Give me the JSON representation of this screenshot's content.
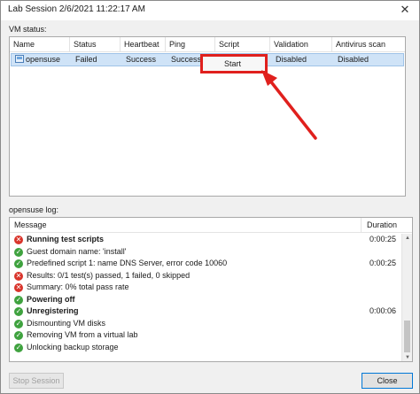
{
  "window": {
    "title": "Lab Session 2/6/2021 11:22:17 AM",
    "close_glyph": "✕"
  },
  "vm_status": {
    "label": "VM status:",
    "columns": [
      "Name",
      "Status",
      "Heartbeat",
      "Ping",
      "Script",
      "Validation",
      "Antivirus scan"
    ],
    "rows": [
      {
        "name": "opensuse",
        "status": "Failed",
        "heartbeat": "Success",
        "ping": "Success",
        "script": "",
        "validation": "Disabled",
        "antivirus": "Disabled"
      }
    ]
  },
  "context_menu": {
    "items": [
      "Start"
    ]
  },
  "log": {
    "label": "opensuse log:",
    "columns": [
      "Message",
      "Duration"
    ],
    "rows": [
      {
        "status": "fail",
        "message": "Running test scripts",
        "bold": true,
        "duration": "0:00:25"
      },
      {
        "status": "ok",
        "message": "Guest domain name: 'install'",
        "bold": false,
        "duration": ""
      },
      {
        "status": "ok",
        "message": "Predefined script 1: name DNS Server, error code 10060",
        "bold": false,
        "duration": "0:00:25"
      },
      {
        "status": "fail",
        "message": "Results: 0/1 test(s) passed, 1 failed, 0 skipped",
        "bold": false,
        "duration": ""
      },
      {
        "status": "fail",
        "message": "Summary: 0% total pass rate",
        "bold": false,
        "duration": ""
      },
      {
        "status": "ok",
        "message": "Powering off",
        "bold": true,
        "duration": ""
      },
      {
        "status": "ok",
        "message": "Unregistering",
        "bold": true,
        "duration": "0:00:06"
      },
      {
        "status": "ok",
        "message": "Dismounting VM disks",
        "bold": false,
        "duration": ""
      },
      {
        "status": "ok",
        "message": "Removing VM from a virtual lab",
        "bold": false,
        "duration": ""
      },
      {
        "status": "ok",
        "message": "Unlocking backup storage",
        "bold": false,
        "duration": ""
      }
    ]
  },
  "buttons": {
    "stop_session": "Stop Session",
    "close": "Close"
  },
  "colors": {
    "selection": "#cfe3f7",
    "annotation_red": "#e0201d",
    "ok": "#3fa23f",
    "fail": "#d9342b"
  }
}
